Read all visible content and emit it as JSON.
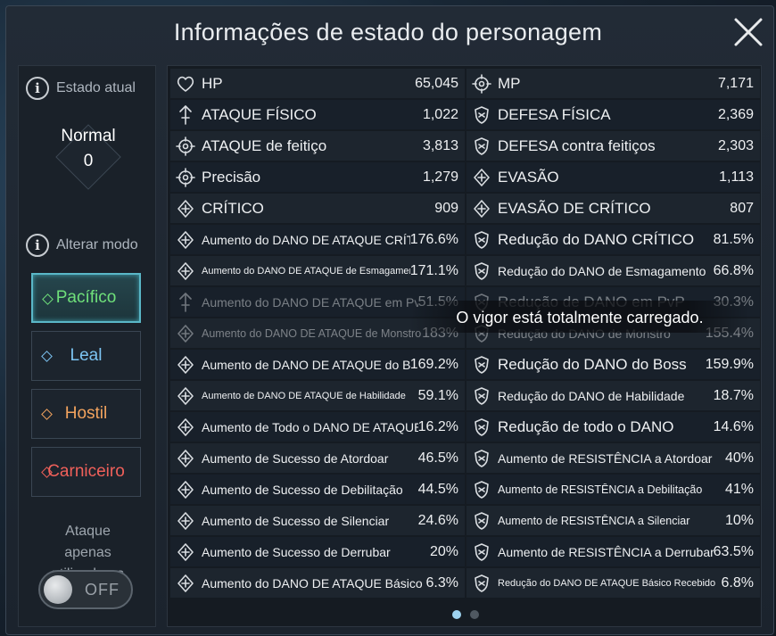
{
  "title": "Informações de estado do personagem",
  "left": {
    "current_state_label": "Estado atual",
    "state_name": "Normal",
    "state_value": "0",
    "change_mode_label": "Alterar modo",
    "modes": [
      {
        "label": "Pacífico",
        "color": "#6fe07a",
        "active": true
      },
      {
        "label": "Leal",
        "color": "#7cc4f2",
        "active": false
      },
      {
        "label": "Hostil",
        "color": "#f2a35e",
        "active": false
      },
      {
        "label": "Carniceiro",
        "color": "#f0605a",
        "active": false
      }
    ],
    "attack_only_label": "Ataque apenas utilizadores",
    "toggle_label": "OFF"
  },
  "stats": [
    {
      "l": {
        "name": "HP",
        "value": "65,045",
        "icon": "heart-icon"
      },
      "r": {
        "name": "MP",
        "value": "7,171",
        "icon": "mana-icon"
      }
    },
    {
      "l": {
        "name": "ATAQUE FÍSICO",
        "value": "1,022",
        "icon": "sword-icon"
      },
      "r": {
        "name": "DEFESA FÍSICA",
        "value": "2,369",
        "icon": "shield-icon"
      }
    },
    {
      "l": {
        "name": "ATAQUE de feitiço",
        "value": "3,813",
        "icon": "spell-icon"
      },
      "r": {
        "name": "DEFESA contra feitiços",
        "value": "2,303",
        "icon": "magic-shield-icon"
      }
    },
    {
      "l": {
        "name": "Precisão",
        "value": "1,279",
        "icon": "crosshair-icon"
      },
      "r": {
        "name": "EVASÃO",
        "value": "1,113",
        "icon": "evasion-icon"
      }
    },
    {
      "l": {
        "name": "CRÍTICO",
        "value": "909",
        "icon": "critical-icon"
      },
      "r": {
        "name": "EVASÃO DE CRÍTICO",
        "value": "807",
        "icon": "crit-evasion-icon"
      }
    },
    {
      "l": {
        "name": "Aumento do DANO DE ATAQUE CRÍTICO",
        "value": "176.6%",
        "icon": "crit-damage-icon"
      },
      "r": {
        "name": "Redução do DANO CRÍTICO",
        "value": "81.5%",
        "icon": "crit-reduction-icon"
      }
    },
    {
      "l": {
        "name": "Aumento do DANO DE ATAQUE de Esmagamento",
        "value": "171.1%",
        "icon": "crush-icon"
      },
      "r": {
        "name": "Redução do DANO de Esmagamento",
        "value": "66.8%",
        "icon": "crush-reduction-icon"
      }
    },
    {
      "l": {
        "name": "Aumento do DANO DE ATAQUE em PvP",
        "value": "51.5%",
        "icon": "pvp-icon"
      },
      "r": {
        "name": "Redução de DANO em PvP",
        "value": "30.3%",
        "icon": "pvp-reduction-icon"
      }
    },
    {
      "l": {
        "name": "Aumento do DANO DE ATAQUE de Monstro",
        "value": "183%",
        "icon": "monster-icon"
      },
      "r": {
        "name": "Redução do DANO de Monstro",
        "value": "155.4%",
        "icon": "monster-reduction-icon"
      }
    },
    {
      "l": {
        "name": "Aumento de DANO DE ATAQUE do Boss",
        "value": "169.2%",
        "icon": "boss-icon"
      },
      "r": {
        "name": "Redução do DANO do Boss",
        "value": "159.9%",
        "icon": "boss-reduction-icon"
      }
    },
    {
      "l": {
        "name": "Aumento de DANO DE ATAQUE de Habilidade",
        "value": "59.1%",
        "icon": "skill-icon"
      },
      "r": {
        "name": "Redução do DANO de Habilidade",
        "value": "18.7%",
        "icon": "skill-reduction-icon"
      }
    },
    {
      "l": {
        "name": "Aumento de Todo o DANO DE ATAQUE",
        "value": "16.2%",
        "icon": "all-damage-icon"
      },
      "r": {
        "name": "Redução de todo o DANO",
        "value": "14.6%",
        "icon": "all-reduction-icon"
      }
    },
    {
      "l": {
        "name": "Aumento de Sucesso de Atordoar",
        "value": "46.5%",
        "icon": "stun-icon"
      },
      "r": {
        "name": "Aumento de RESISTÊNCIA a Atordoar",
        "value": "40%",
        "icon": "stun-resist-icon"
      }
    },
    {
      "l": {
        "name": "Aumento de Sucesso de Debilitação",
        "value": "44.5%",
        "icon": "debilitate-icon"
      },
      "r": {
        "name": "Aumento de RESISTÊNCIA a Debilitação",
        "value": "41%",
        "icon": "debilitate-resist-icon"
      }
    },
    {
      "l": {
        "name": "Aumento de Sucesso de Silenciar",
        "value": "24.6%",
        "icon": "silence-icon"
      },
      "r": {
        "name": "Aumento de RESISTÊNCIA a Silenciar",
        "value": "10%",
        "icon": "silence-resist-icon"
      }
    },
    {
      "l": {
        "name": "Aumento de Sucesso de Derrubar",
        "value": "20%",
        "icon": "knockdown-icon"
      },
      "r": {
        "name": "Aumento de RESISTÊNCIA a Derrubar",
        "value": "63.5%",
        "icon": "knockdown-resist-icon"
      }
    },
    {
      "l": {
        "name": "Aumento do DANO DE ATAQUE Básico",
        "value": "6.3%",
        "icon": "basic-attack-icon"
      },
      "r": {
        "name": "Redução do DANO DE ATAQUE Básico Recebido",
        "value": "6.8%",
        "icon": "basic-reduction-icon"
      }
    }
  ],
  "toast": "O vigor está totalmente carregado.",
  "pagination": {
    "pages": 2,
    "current": 1
  }
}
